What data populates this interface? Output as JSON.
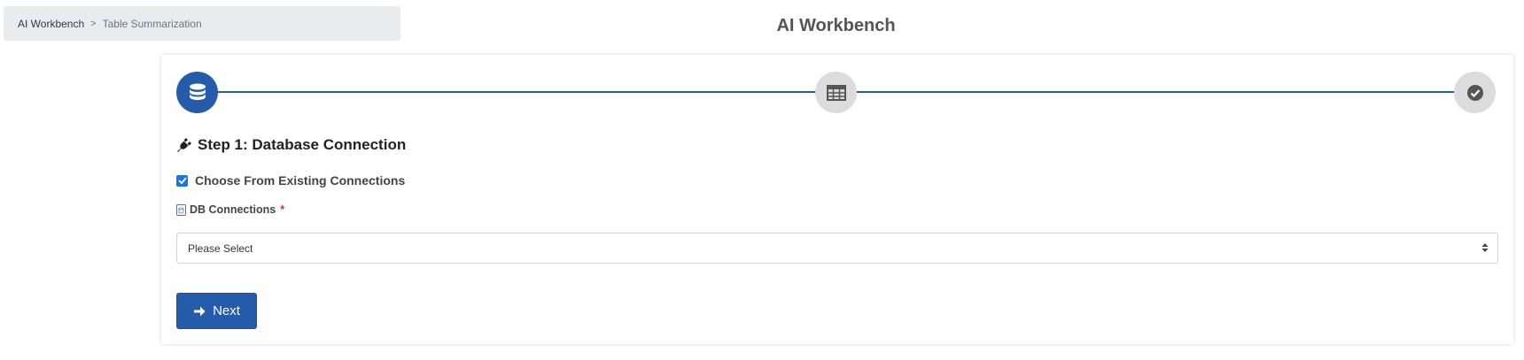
{
  "breadcrumb": {
    "home": "AI Workbench",
    "separator": ">",
    "current": "Table Summarization"
  },
  "page_title": "AI Workbench",
  "stepper": {
    "steps": [
      {
        "icon": "database-icon",
        "state": "active"
      },
      {
        "icon": "table-icon",
        "state": "inactive"
      },
      {
        "icon": "check-circle-icon",
        "state": "inactive"
      }
    ],
    "line_color": "#245bab"
  },
  "step_section": {
    "heading_icon": "plug-icon",
    "heading": "Step 1: Database Connection",
    "checkbox_label": "Choose From Existing Connections",
    "checkbox_checked": true,
    "db_label_icon": "database-doc-icon",
    "db_label": "DB Connections",
    "required_mark": "*",
    "select_value": "Please Select"
  },
  "actions": {
    "next_icon": "arrow-right-icon",
    "next_label": "Next"
  },
  "colors": {
    "primary": "#245bab",
    "checkbox": "#1a73e8",
    "required": "#d9302c",
    "inactive_step": "#dcdcdc"
  }
}
